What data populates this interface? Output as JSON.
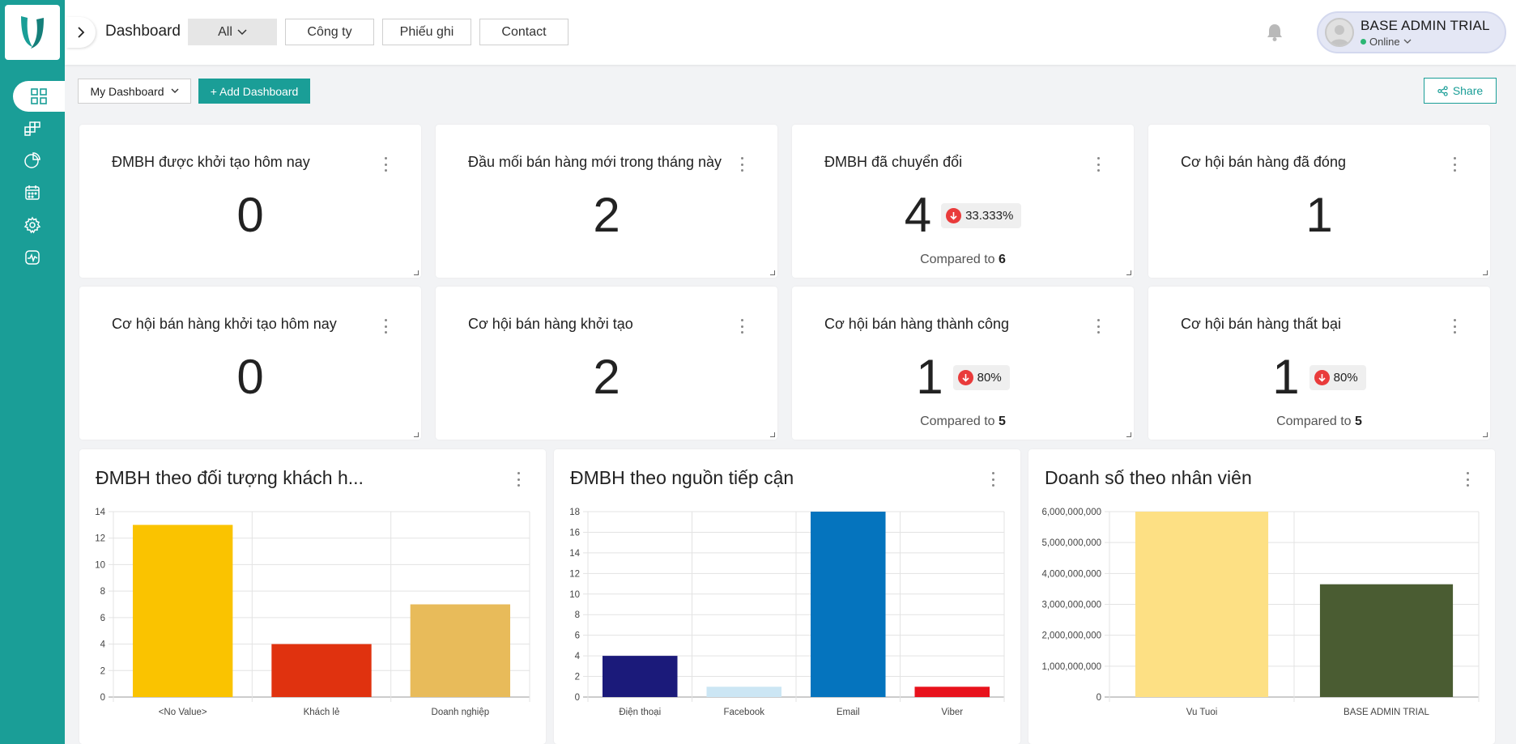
{
  "header": {
    "title": "Dashboard",
    "tabs": [
      {
        "label": "All",
        "active": true,
        "dropdown": true
      },
      {
        "label": "Công ty",
        "active": false
      },
      {
        "label": "Phiếu ghi",
        "active": false
      },
      {
        "label": "Contact",
        "active": false
      }
    ],
    "user": {
      "name": "BASE ADMIN TRIAL",
      "status": "Online"
    }
  },
  "sidebar": {
    "icons": [
      "dashboard-icon",
      "modules-icon",
      "pie-chart-icon",
      "calendar-icon",
      "settings-icon",
      "activity-icon"
    ],
    "brand_color": "#1a9e97"
  },
  "toolbar": {
    "dashboard_select": "My Dashboard",
    "add_dashboard": "+ Add Dashboard",
    "share": "Share"
  },
  "kpis": [
    {
      "title": "ĐMBH được khởi tạo hôm nay",
      "value": "0"
    },
    {
      "title": "Đầu mối bán hàng mới trong tháng này",
      "value": "2"
    },
    {
      "title": "ĐMBH đã chuyển đổi",
      "value": "4",
      "change": "33.333%",
      "compare_label": "Compared to",
      "compare_value": "6"
    },
    {
      "title": "Cơ hội bán hàng đã đóng",
      "value": "1"
    },
    {
      "title": "Cơ hội bán hàng khởi tạo hôm nay",
      "value": "0"
    },
    {
      "title": "Cơ hội bán hàng khởi tạo",
      "value": "2"
    },
    {
      "title": "Cơ hội bán hàng thành công",
      "value": "1",
      "change": "80%",
      "compare_label": "Compared to",
      "compare_value": "5"
    },
    {
      "title": "Cơ hội bán hàng thất bại",
      "value": "1",
      "change": "80%",
      "compare_label": "Compared to",
      "compare_value": "5"
    }
  ],
  "charts": {
    "c1_title": "ĐMBH theo đối tượng khách h...",
    "c2_title": "ĐMBH theo nguồn tiếp cận",
    "c3_title": "Doanh số theo nhân viên"
  },
  "chart_data": [
    {
      "type": "bar",
      "title": "ĐMBH theo đối tượng khách h...",
      "categories": [
        "<No Value>",
        "Khách lẻ",
        "Doanh nghiệp"
      ],
      "values": [
        13,
        4,
        7
      ],
      "colors": [
        "#fac300",
        "#e0320f",
        "#e8bb5a"
      ],
      "yticks": [
        "0",
        "2",
        "4",
        "6",
        "8",
        "10",
        "12",
        "14"
      ],
      "ylim": [
        0,
        14
      ],
      "grid": true
    },
    {
      "type": "bar",
      "title": "ĐMBH theo nguồn tiếp cận",
      "categories": [
        "Điện thoại",
        "Facebook",
        "Email",
        "Viber"
      ],
      "values": [
        4,
        1,
        18,
        1
      ],
      "colors": [
        "#1b1a7a",
        "#cce6f4",
        "#0574be",
        "#e8121c"
      ],
      "yticks": [
        "0",
        "2",
        "4",
        "6",
        "8",
        "10",
        "12",
        "14",
        "16",
        "18"
      ],
      "ylim": [
        0,
        18
      ],
      "grid": true
    },
    {
      "type": "bar",
      "title": "Doanh số theo nhân viên",
      "categories": [
        "Vu Tuoi",
        "BASE ADMIN TRIAL"
      ],
      "values": [
        6000000000,
        3650000000
      ],
      "colors": [
        "#fde084",
        "#4a5c32"
      ],
      "yticks": [
        "0",
        "1,000,000,000",
        "2,000,000,000",
        "3,000,000,000",
        "4,000,000,000",
        "5,000,000,000",
        "6,000,000,000"
      ],
      "ylim": [
        0,
        6000000000
      ],
      "grid": true
    }
  ]
}
